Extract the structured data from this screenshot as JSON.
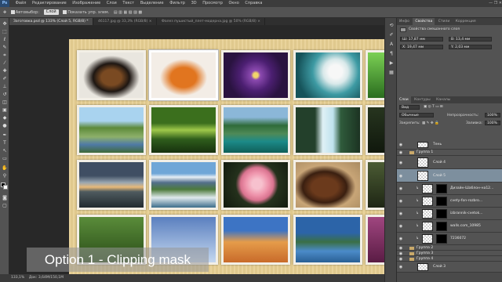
{
  "app": {
    "logo": "Ps"
  },
  "menu": [
    "Файл",
    "Редактирование",
    "Изображение",
    "Слои",
    "Текст",
    "Выделение",
    "Фильтр",
    "3D",
    "Просмотр",
    "Окно",
    "Справка"
  ],
  "window_controls": "— ❐ ✕",
  "options": {
    "auto_select_label": "Автовыбор:",
    "auto_select_value": "Слой",
    "transform_label": "Показать упр. элем."
  },
  "tabs": [
    {
      "label": "Заготовка.psd @ 133% (Слой 5, RGB/8) *",
      "active": true
    },
    {
      "label": "46117.jpg @ 33,3% (RGB/8) ×",
      "active": false
    },
    {
      "label": "Фалез пушистый_плет-модерна.jpg @ 50% (RGB/8) ×",
      "active": false
    }
  ],
  "caption": "Option 1 - Clipping mask",
  "status": {
    "zoom": "133,1%",
    "doc": "Док: 3,64М/150,1М"
  },
  "properties": {
    "tabs": [
      "Инфо",
      "Свойства",
      "Стили",
      "Коррекция"
    ],
    "title": "Свойства смешанного слоя",
    "w": "Ш: 17,87 мм",
    "h": "В: 13,4 мм",
    "x": "X: 19,47 мм",
    "y": "Y: 2,03 мм"
  },
  "layers_panel": {
    "tabs": [
      "Слои",
      "Контуры",
      "Каналы"
    ],
    "kind_label": "Вид",
    "blend_mode": "Обычные",
    "opacity_label": "Непрозрачность:",
    "opacity_value": "100%",
    "lock_label": "Закрепить:",
    "fill_label": "Заливка:",
    "fill_value": "100%",
    "rows": [
      {
        "name": "Тень",
        "kind": "layer"
      },
      {
        "name": "Группа 1",
        "kind": "group"
      },
      {
        "name": "Слой 4",
        "kind": "layer"
      },
      {
        "name": "Слой 5",
        "kind": "layer",
        "selected": true
      },
      {
        "name": "Дизайн-Шаблон-на12...",
        "kind": "clip"
      },
      {
        "name": "cvety-fon-rozbro...",
        "kind": "clip"
      },
      {
        "name": "izbrannik-cvetok...",
        "kind": "clip"
      },
      {
        "name": "walls.com_10985",
        "kind": "clip"
      },
      {
        "name": "7236072",
        "kind": "clip"
      },
      {
        "name": "Группа 2",
        "kind": "group"
      },
      {
        "name": "Группа 3",
        "kind": "group"
      },
      {
        "name": "Группа 4",
        "kind": "group"
      },
      {
        "name": "Слой 3",
        "kind": "layer"
      }
    ]
  },
  "colors": {
    "accent": "#7d8f9e",
    "panel": "#535353",
    "canvas_bg": "#282828",
    "paper": "#e7cf92"
  }
}
